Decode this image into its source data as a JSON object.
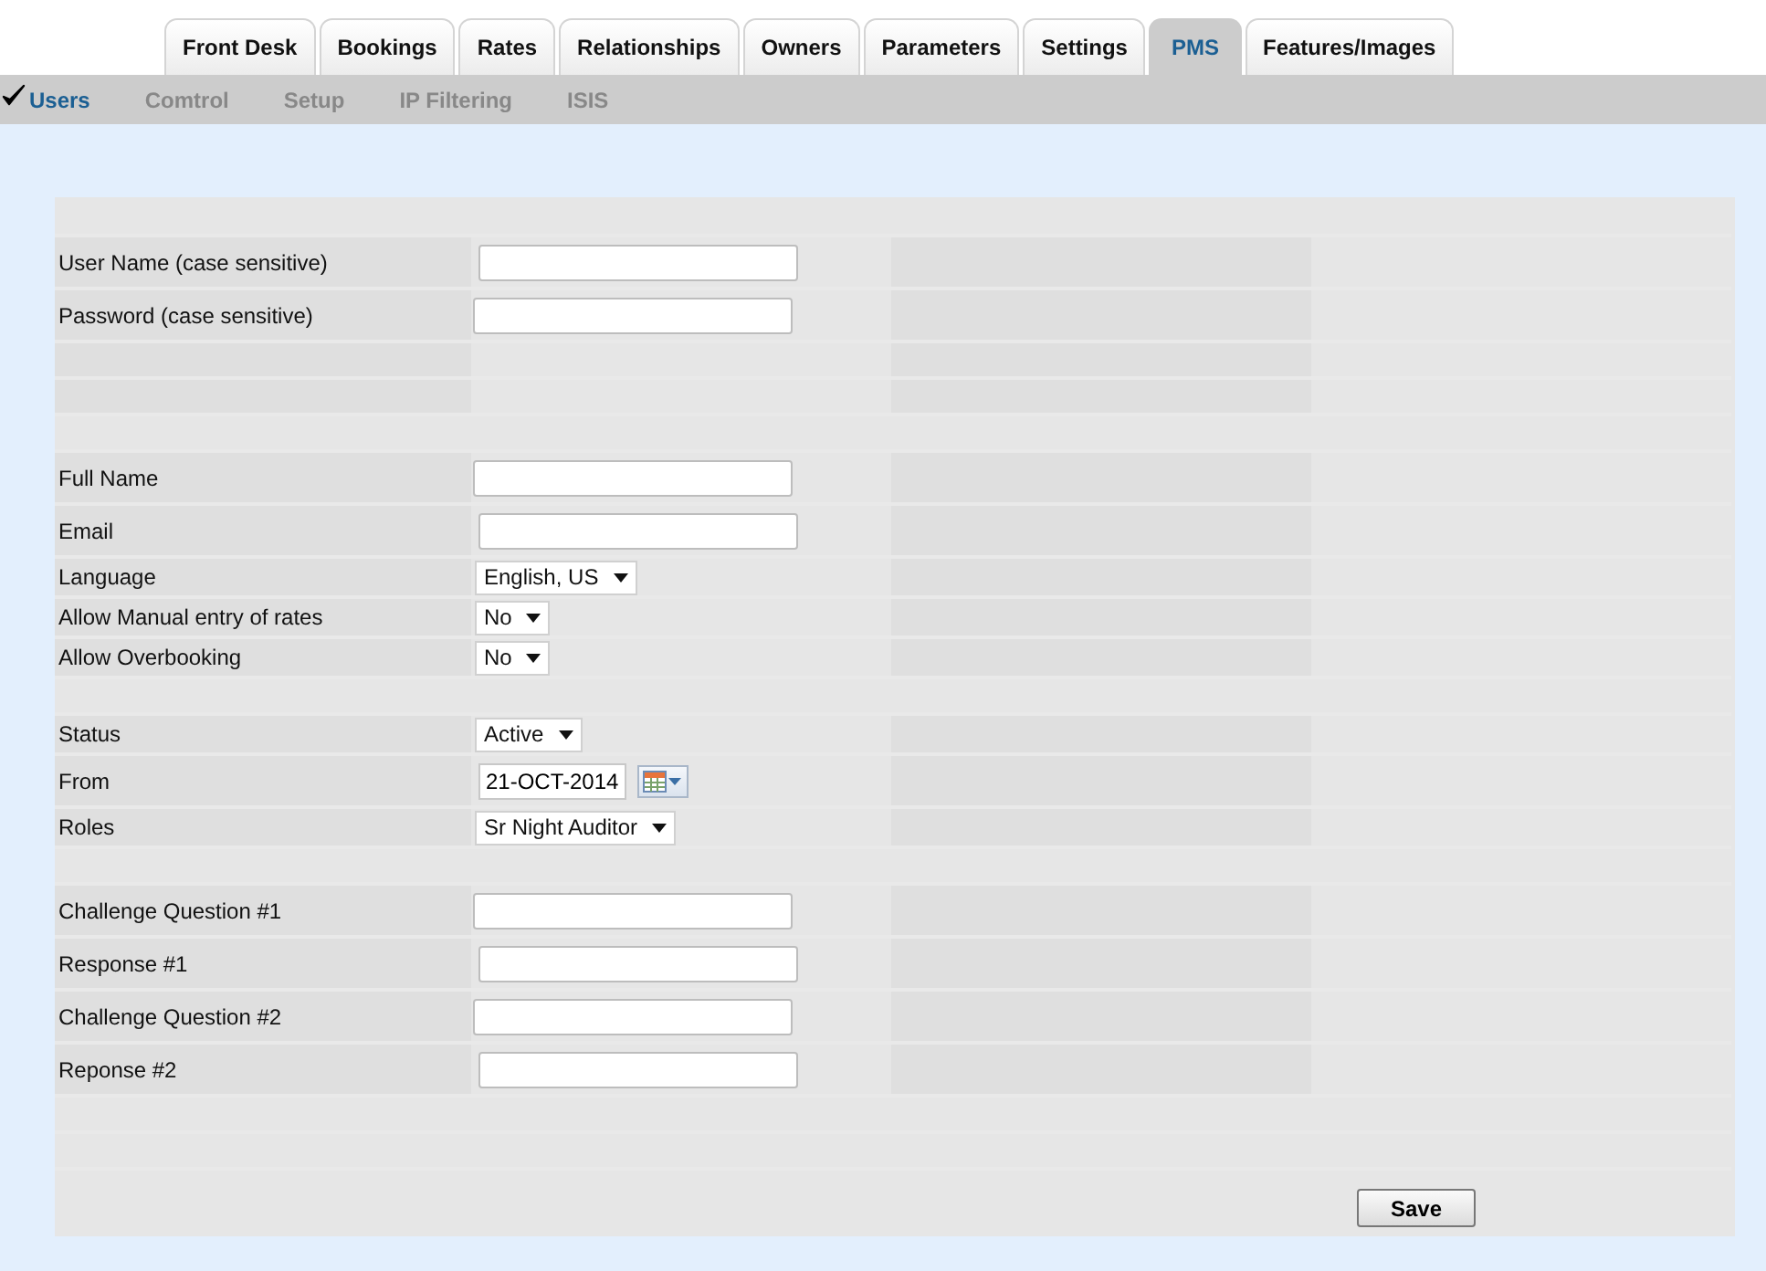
{
  "tabs": [
    {
      "label": "Front Desk",
      "selected": false
    },
    {
      "label": "Bookings",
      "selected": false
    },
    {
      "label": "Rates",
      "selected": false
    },
    {
      "label": "Relationships",
      "selected": false
    },
    {
      "label": "Owners",
      "selected": false
    },
    {
      "label": "Parameters",
      "selected": false
    },
    {
      "label": "Settings",
      "selected": false
    },
    {
      "label": "PMS",
      "selected": true
    },
    {
      "label": "Features/Images",
      "selected": false
    }
  ],
  "subnav": [
    {
      "label": "Users",
      "selected": true
    },
    {
      "label": "Comtrol",
      "selected": false
    },
    {
      "label": "Setup",
      "selected": false
    },
    {
      "label": "IP Filtering",
      "selected": false
    },
    {
      "label": "ISIS",
      "selected": false
    }
  ],
  "form": {
    "rows": [
      {
        "kind": "text",
        "label": "User Name (case sensitive)"
      },
      {
        "kind": "text",
        "label": "Password (case sensitive)"
      },
      {
        "kind": "blank"
      },
      {
        "kind": "blank"
      },
      {
        "kind": "spacer"
      },
      {
        "kind": "text",
        "label": "Full Name"
      },
      {
        "kind": "text",
        "label": "Email"
      },
      {
        "kind": "select",
        "label": "Language",
        "value": "English, US"
      },
      {
        "kind": "select",
        "label": "Allow Manual entry of rates",
        "value": "No"
      },
      {
        "kind": "select",
        "label": "Allow Overbooking",
        "value": "No"
      },
      {
        "kind": "spacer"
      },
      {
        "kind": "select",
        "label": "Status",
        "value": "Active"
      },
      {
        "kind": "date",
        "label": "From",
        "value": "21-OCT-2014"
      },
      {
        "kind": "select",
        "label": "Roles",
        "value": "Sr Night Auditor"
      },
      {
        "kind": "spacer"
      },
      {
        "kind": "text",
        "label": "Challenge Question #1"
      },
      {
        "kind": "text",
        "label": "Response #1"
      },
      {
        "kind": "text",
        "label": "Challenge Question #2"
      },
      {
        "kind": "text",
        "label": "Reponse #2"
      },
      {
        "kind": "spacer"
      },
      {
        "kind": "spacer"
      }
    ],
    "save_button": "Save"
  }
}
